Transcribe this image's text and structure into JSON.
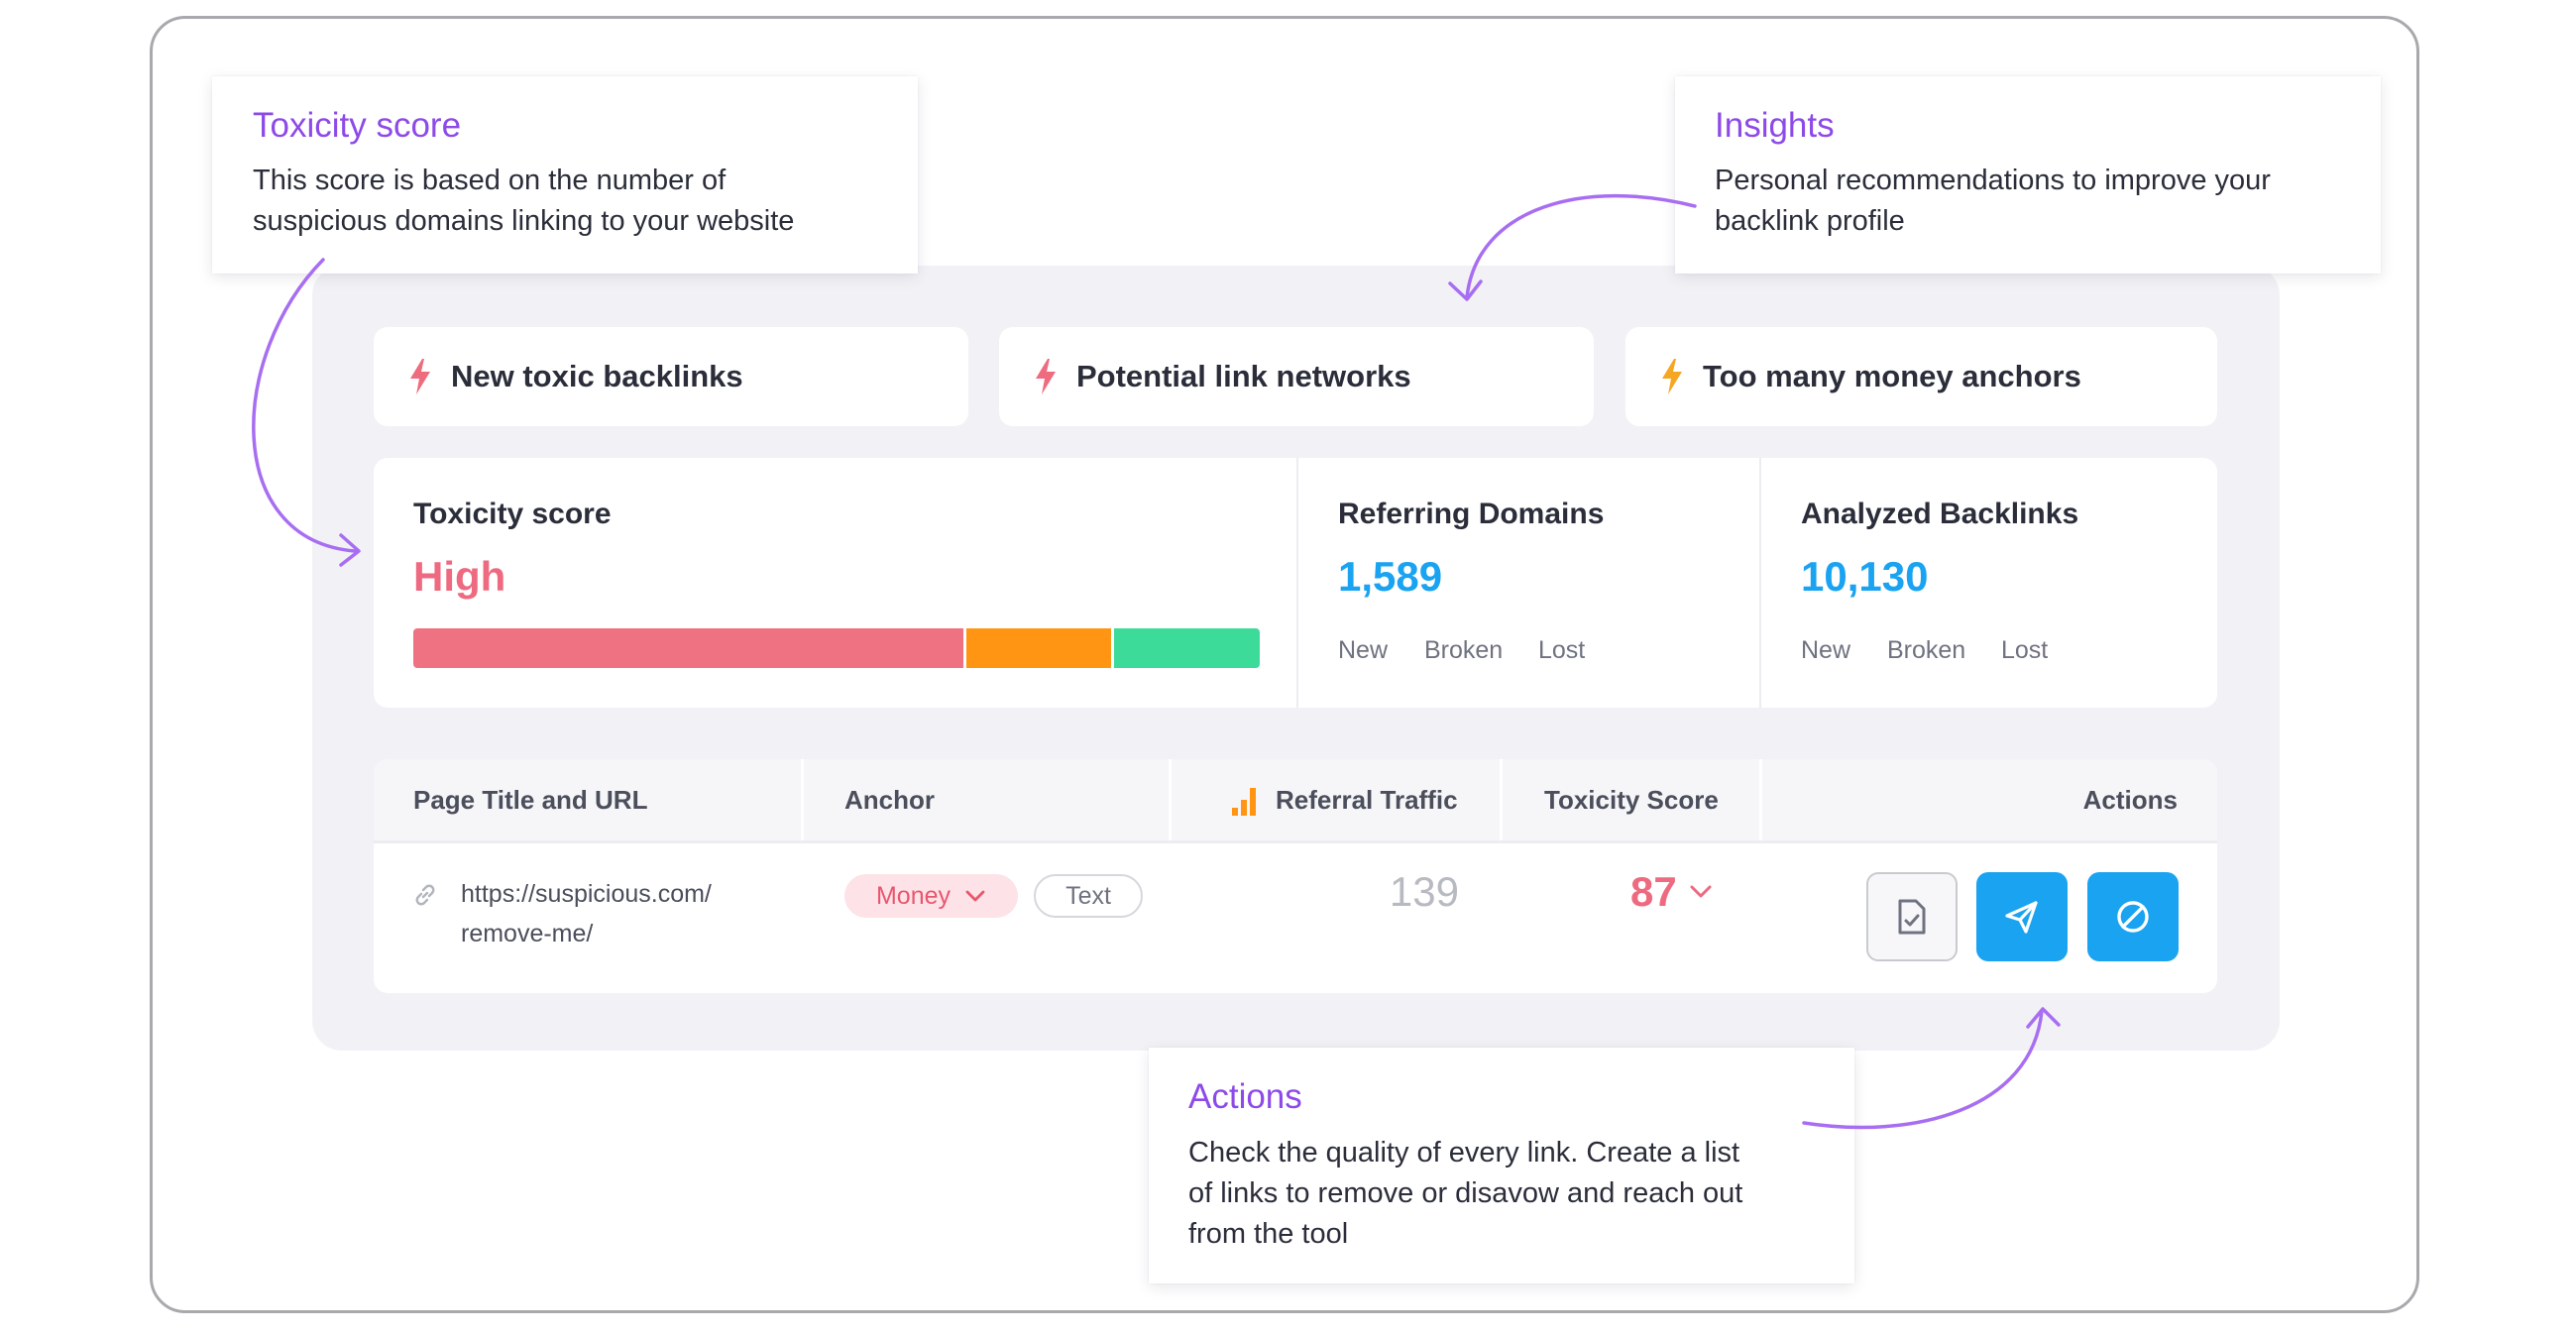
{
  "insights": [
    {
      "label": "New toxic backlinks",
      "bolt_color": "#ef6b7e"
    },
    {
      "label": "Potential link networks",
      "bolt_color": "#ef6b7e"
    },
    {
      "label": "Too many money anchors",
      "bolt_color": "#f5a623"
    }
  ],
  "metrics": {
    "toxicity": {
      "title": "Toxicity score",
      "value": "High",
      "color": "#ee6a80"
    },
    "referring_domains": {
      "title": "Referring Domains",
      "value": "1,589",
      "new": "New",
      "broken": "Broken",
      "lost": "Lost"
    },
    "analyzed_backlinks": {
      "title": "Analyzed Backlinks",
      "value": "10,130",
      "new": "New",
      "broken": "Broken",
      "lost": "Lost"
    },
    "value_color": "#1aa3f0",
    "score_bar": [
      {
        "fraction": 0.655,
        "color": "#ef7282"
      },
      {
        "fraction": 0.172,
        "color": "#ff9513"
      },
      {
        "fraction": 0.173,
        "color": "#3ddb9a"
      }
    ]
  },
  "table": {
    "headers": {
      "page": "Page Title and URL",
      "anchor": "Anchor",
      "traffic": "Referral Traffic",
      "toxicity": "Toxicity Score",
      "actions": "Actions"
    },
    "row": {
      "url_line1": "https://suspicious.com/",
      "url_line2": "remove-me/",
      "anchor_money": "Money",
      "anchor_text": "Text",
      "traffic": "139",
      "toxicity": "87"
    },
    "actions": [
      "review-icon",
      "send-icon",
      "disavow-icon"
    ],
    "action_color": "#1aa3f0"
  },
  "tooltips": {
    "toxicity": {
      "title": "Toxicity score",
      "line1": "This score is based on the number of",
      "line2": "suspicious domains linking to your website"
    },
    "insights": {
      "title": "Insights",
      "line1": "Personal recommendations to improve your",
      "line2": "backlink profile"
    },
    "actions": {
      "title": "Actions",
      "line1": "Check the quality of every link. Create a list",
      "line2": "of links to remove or disavow and reach out",
      "line3": "from the tool"
    }
  },
  "accent_color": "#8d4ae8"
}
